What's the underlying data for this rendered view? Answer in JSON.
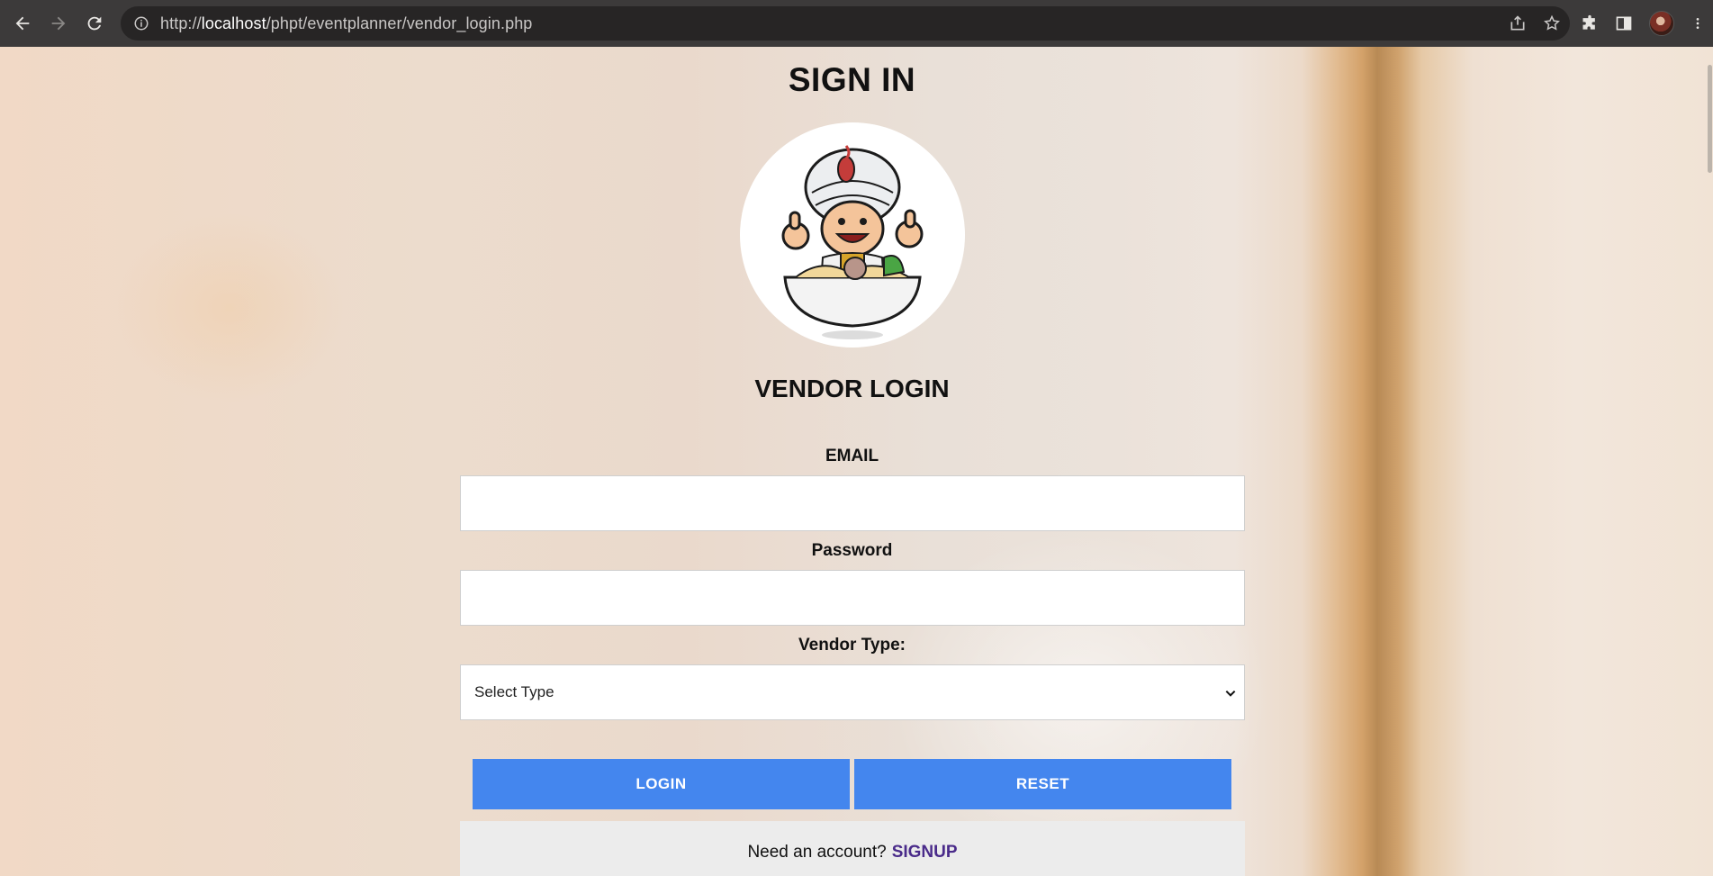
{
  "browser": {
    "url_prefix": "http://",
    "url_host": "localhost",
    "url_path": "/phpt/eventplanner/vendor_login.php"
  },
  "page": {
    "heading": "SIGN IN",
    "subheading": "VENDOR LOGIN",
    "email_label": "EMAIL",
    "email_value": "",
    "password_label": "Password",
    "password_value": "",
    "vendor_type_label": "Vendor Type:",
    "vendor_type_selected": "Select Type",
    "login_button": "LOGIN",
    "reset_button": "RESET",
    "signup_prompt": "Need an account?",
    "signup_link": "SIGNUP"
  },
  "colors": {
    "button": "#4486ee",
    "link": "#4a2b8a",
    "chrome": "#3c3a3a"
  }
}
